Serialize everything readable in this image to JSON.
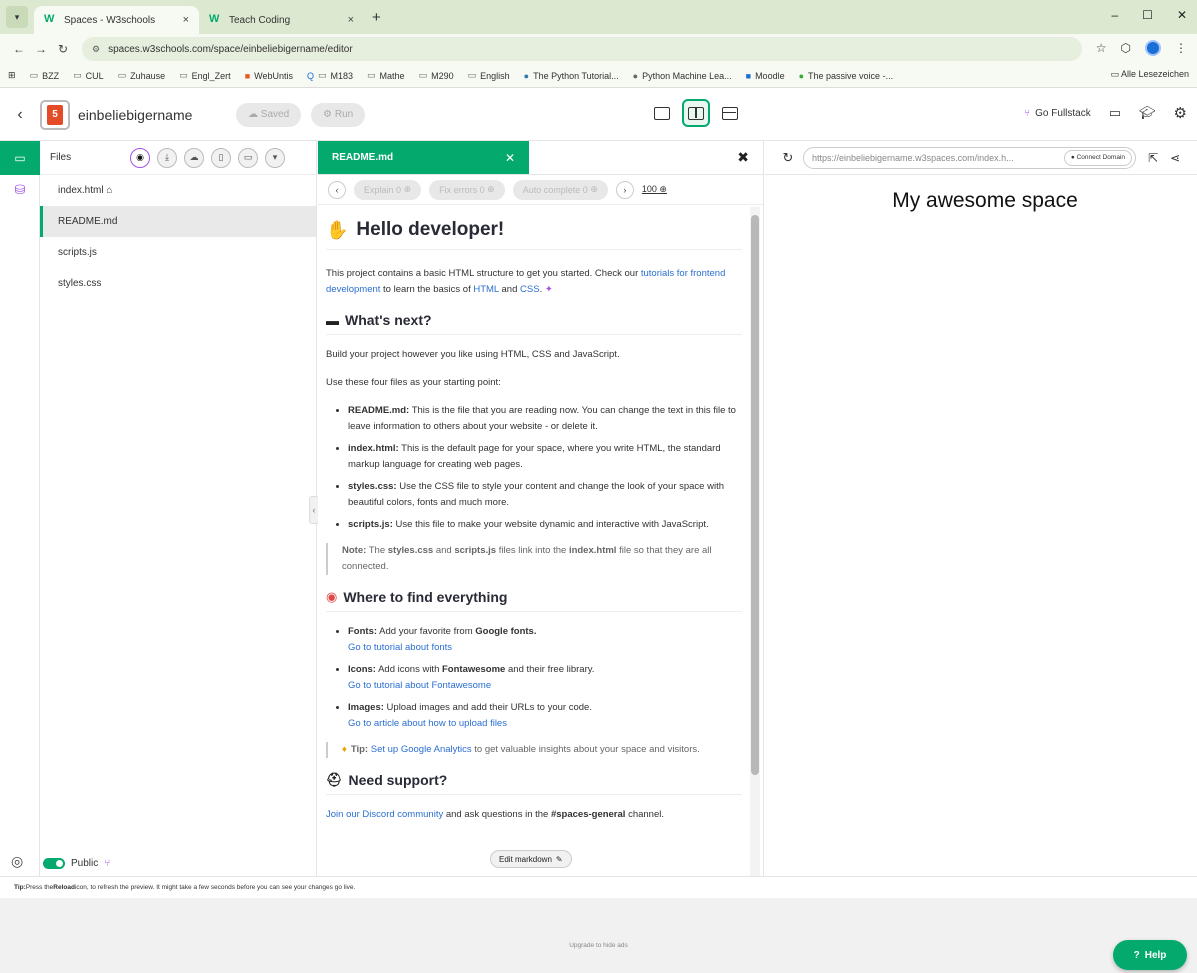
{
  "browser": {
    "tabs": [
      {
        "favicon": "W",
        "label": "Spaces - W3schools",
        "close": "×"
      },
      {
        "favicon": "W",
        "label": "Teach Coding",
        "close": "×"
      }
    ],
    "new_tab": "+",
    "url": "spaces.w3schools.com/space/einbeliebigername/editor",
    "bookmarks": [
      "BZZ",
      "CUL",
      "Zuhause",
      "Engl_Zert",
      "WebUntis",
      "M183",
      "Mathe",
      "M290",
      "English",
      "The Python Tutorial...",
      "Python Machine Lea...",
      "Moodle",
      "The passive voice -..."
    ],
    "bookmarks_all": "Alle Lesezeichen"
  },
  "header": {
    "project_name": "einbeliebigername",
    "saved_label": "Saved",
    "run_label": "Run",
    "go_fullstack": "Go Fullstack"
  },
  "files": {
    "title": "Files",
    "items": [
      "index.html",
      "README.md",
      "scripts.js",
      "styles.css"
    ],
    "public_label": "Public"
  },
  "editor": {
    "tab_label": "README.md",
    "ai": {
      "explain": "Explain",
      "explain_count": "0",
      "fix_errors": "Fix errors",
      "fix_count": "0",
      "auto_complete": "Auto complete",
      "auto_count": "0",
      "credits": "100"
    },
    "content": {
      "h1": "Hello developer!",
      "intro_1": "This project contains a basic HTML structure to get you started. Check our ",
      "intro_link": "tutorials for frontend development",
      "intro_2": " to learn the basics of ",
      "intro_html": "HTML",
      "intro_and": " and ",
      "intro_css": "CSS",
      "intro_end": ".",
      "h2_next": "What's next?",
      "next_p1": "Build your project however you like using HTML, CSS and JavaScript.",
      "next_p2": "Use these four files as your starting point:",
      "files_list": [
        {
          "name": "README.md:",
          "text": " This is the file that you are reading now. You can change the text in this file to leave information to others about your website - or delete it."
        },
        {
          "name": "index.html:",
          "text": " This is the default page for your space, where you write HTML, the standard markup language for creating web pages."
        },
        {
          "name": "styles.css:",
          "text": " Use the CSS file to style your content and change the look of your space with beautiful colors, fonts and much more."
        },
        {
          "name": "scripts.js:",
          "text": " Use this file to make your website dynamic and interactive with JavaScript."
        }
      ],
      "note_label": "Note:",
      "note_1": " The ",
      "note_styles": "styles.css",
      "note_and": " and ",
      "note_scripts": "scripts.js",
      "note_2": " files link into the ",
      "note_index": "index.html",
      "note_3": " file so that they are all connected.",
      "h2_find": "Where to find everything",
      "find_list": [
        {
          "name": "Fonts:",
          "text": " Add your favorite from ",
          "bold2": "Google fonts.",
          "link": "Go to tutorial about fonts"
        },
        {
          "name": "Icons:",
          "text": " Add icons with ",
          "bold2": "Fontawesome",
          "text2": " and their free library.",
          "link": "Go to tutorial about Fontawesome"
        },
        {
          "name": "Images:",
          "text": " Upload images and add their URLs to your code.",
          "link": "Go to article about how to upload files"
        }
      ],
      "tip_label": "Tip:",
      "tip_link": "Set up Google Analytics",
      "tip_text": " to get valuable insights about your space and visitors.",
      "h2_support": "Need support?",
      "support_link": "Join our Discord community",
      "support_text": " and ask questions in the ",
      "support_channel": "#spaces-general",
      "support_end": " channel."
    },
    "edit_markdown": "Edit markdown"
  },
  "preview": {
    "url": "https://einbeliebigername.w3spaces.com/index.h...",
    "connect_domain": "Connect Domain",
    "heading": "My awesome space"
  },
  "footer": {
    "tip_label": "Tip:",
    "tip_1": " Press the ",
    "tip_reload": "Reload",
    "tip_2": " icon, to refresh the preview. It might take a few seconds before you can see your changes go live.",
    "upgrade": "Upgrade to hide ads",
    "help": "Help"
  },
  "colors": {
    "accent": "#04aa6d",
    "purple": "#a054e8",
    "link": "#2b6fd1"
  }
}
